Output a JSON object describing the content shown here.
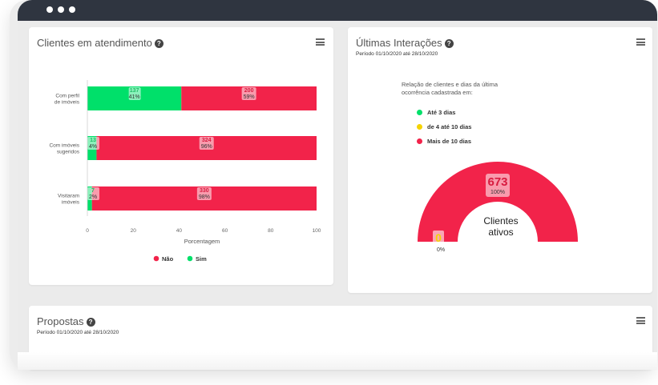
{
  "colors": {
    "nao": "#f2234a",
    "sim": "#00e06a",
    "mid": "#f5d300",
    "titlebar": "#2f3540"
  },
  "card1": {
    "title": "Clientes em atendimento",
    "help_icon": "?",
    "menu_icon": "hamburger-menu-icon",
    "xlabel": "Porcentagem",
    "legend": [
      {
        "label": "Não",
        "color": "#f2234a"
      },
      {
        "label": "Sim",
        "color": "#00e06a"
      }
    ]
  },
  "card2": {
    "title": "Últimas Interações",
    "help_icon": "?",
    "subtitle": "Período 01/10/2020 até 28/10/2020",
    "description_1": "Relação de clientes e dias da última",
    "description_2": "ocorrência cadastrada em:",
    "legend": [
      {
        "label": "Até 3 dias",
        "color": "#00e06a"
      },
      {
        "label": "de 4 até 10 dias",
        "color": "#f5d300"
      },
      {
        "label": "Mais de 10 dias",
        "color": "#f2234a"
      }
    ],
    "center_line1": "Clientes",
    "center_line2": "ativos"
  },
  "card3": {
    "title": "Propostas",
    "help_icon": "?",
    "subtitle": "Período 01/10/2020 até 28/10/2020"
  },
  "chart_data": [
    {
      "type": "bar",
      "orientation": "horizontal",
      "stacked": true,
      "categories": [
        "Com perfil de imóveis",
        "Com imóveis sugeridos",
        "Visitaram imóveis"
      ],
      "category_lines": [
        [
          "Com perfil",
          "de imóveis"
        ],
        [
          "Com imóveis",
          "sugeridos"
        ],
        [
          "Visitaram",
          "imóveis"
        ]
      ],
      "series": [
        {
          "name": "Sim",
          "counts": [
            "137",
            "13",
            "7"
          ],
          "values": [
            41,
            4,
            2
          ],
          "labels": [
            "41%",
            "4%",
            "2%"
          ]
        },
        {
          "name": "Não",
          "counts": [
            "200",
            "324",
            "330"
          ],
          "values": [
            59,
            96,
            98
          ],
          "labels": [
            "59%",
            "96%",
            "98%"
          ]
        }
      ],
      "xlabel": "Porcentagem",
      "xlim": [
        0,
        100
      ],
      "xticks": [
        "0",
        "20",
        "40",
        "60",
        "80",
        "100"
      ],
      "legend_position": "bottom"
    },
    {
      "type": "pie",
      "variant": "semi-donut",
      "slices": [
        {
          "name": "Até 3 dias",
          "value": 0,
          "count_label": "0",
          "percent_label": "0%"
        },
        {
          "name": "de 4 até 10 dias",
          "value": 0,
          "count_label": "",
          "percent_label": ""
        },
        {
          "name": "Mais de 10 dias",
          "value": 673,
          "count_label": "673",
          "percent_label": "100%"
        }
      ],
      "legend_position": "top"
    }
  ]
}
